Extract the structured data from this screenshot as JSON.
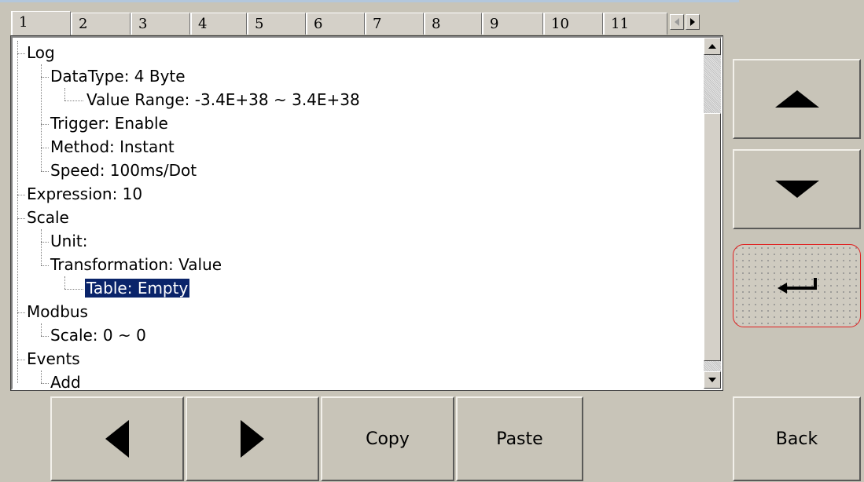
{
  "tabs": [
    "1",
    "2",
    "3",
    "4",
    "5",
    "6",
    "7",
    "8",
    "9",
    "10",
    "11"
  ],
  "active_tab": "1",
  "tree": [
    {
      "label": "Log",
      "level": 0,
      "selected": false
    },
    {
      "label": "DataType: 4 Byte",
      "level": 1,
      "selected": false
    },
    {
      "label": "Value Range: -3.4E+38  ~ 3.4E+38",
      "level": 2,
      "selected": false
    },
    {
      "label": "Trigger: Enable",
      "level": 1,
      "selected": false
    },
    {
      "label": "Method: Instant",
      "level": 1,
      "selected": false
    },
    {
      "label": "Speed: 100ms/Dot",
      "level": 1,
      "selected": false
    },
    {
      "label": "Expression: 10",
      "level": 0,
      "selected": false
    },
    {
      "label": "Scale",
      "level": 0,
      "selected": false
    },
    {
      "label": "Unit:",
      "level": 1,
      "selected": false
    },
    {
      "label": "Transformation: Value",
      "level": 1,
      "selected": false
    },
    {
      "label": "Table: Empty",
      "level": 2,
      "selected": true
    },
    {
      "label": "Modbus",
      "level": 0,
      "selected": false
    },
    {
      "label": "Scale: 0 ~ 0",
      "level": 1,
      "selected": false
    },
    {
      "label": "Events",
      "level": 0,
      "selected": false
    },
    {
      "label": "Add",
      "level": 1,
      "selected": false
    }
  ],
  "buttons": {
    "copy": "Copy",
    "paste": "Paste",
    "back": "Back"
  },
  "icons": {
    "up": "triangle-up-icon",
    "down": "triangle-down-icon",
    "enter": "enter-return-icon",
    "left": "triangle-left-icon",
    "right": "triangle-right-icon"
  },
  "colors": {
    "selection": "#0a246a",
    "enter_border": "#e02020",
    "panel_bg": "#c8c4b8"
  }
}
